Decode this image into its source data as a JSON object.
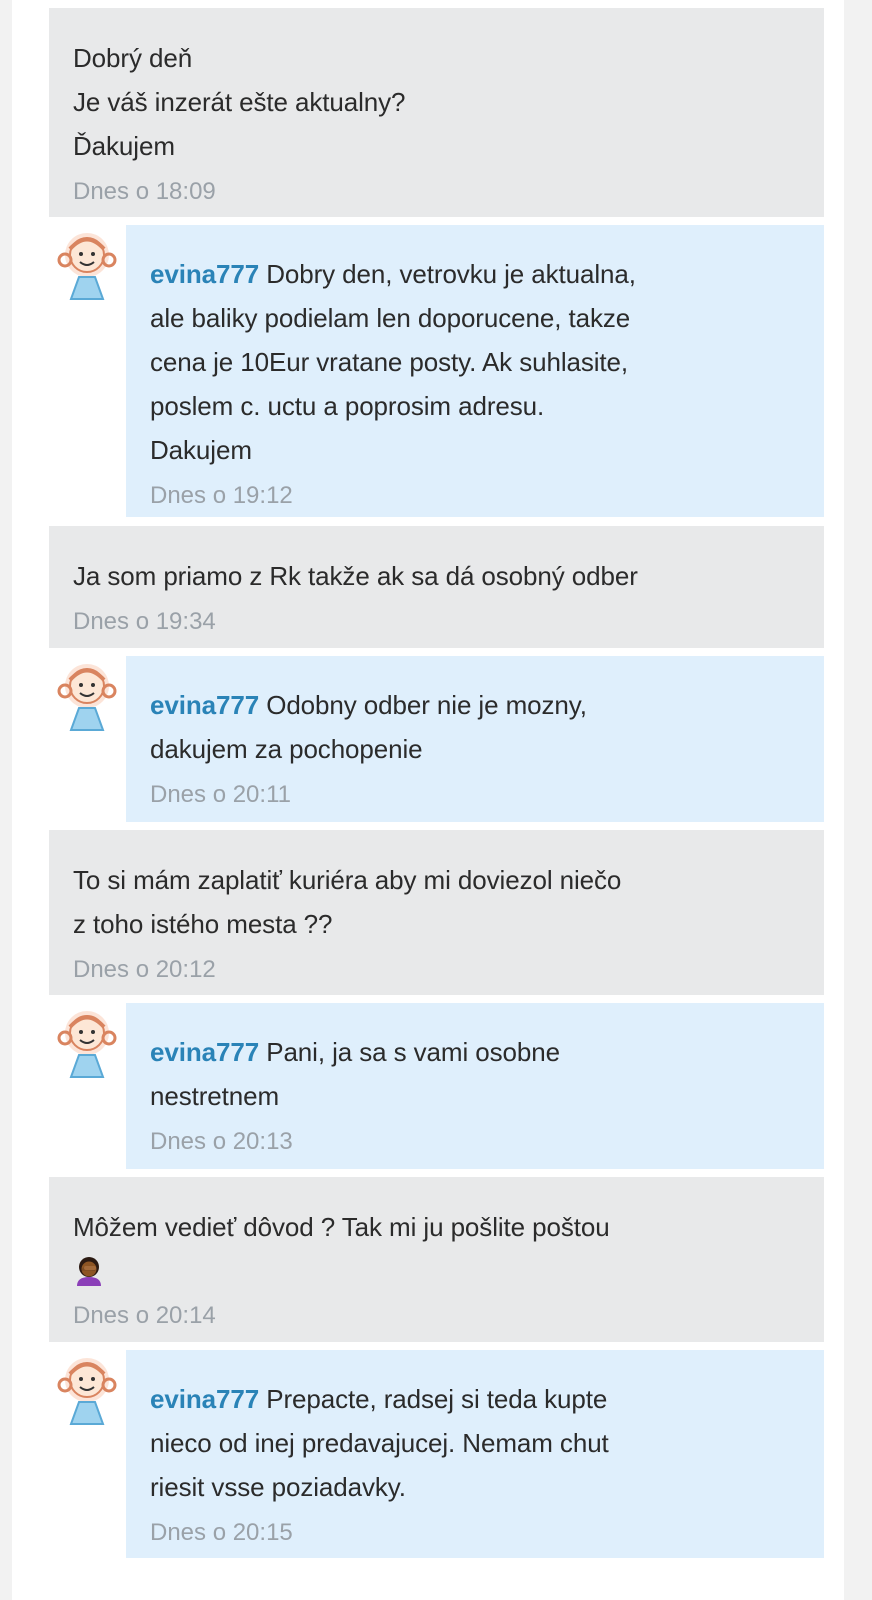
{
  "messages": [
    {
      "kind": "buyer",
      "text": "Dobrý deň\nJe váš inzerát ešte aktualny?\nĎakujem",
      "time": "Dnes o 18:09"
    },
    {
      "kind": "seller",
      "user": "evina777",
      "text": "Dobry den, vetrovku je aktualna,\nale baliky podielam len doporucene, takze\ncena je 10Eur vratane posty. Ak suhlasite,\nposlem c. uctu a poprosim adresu.\nDakujem",
      "time": "Dnes o 19:12"
    },
    {
      "kind": "buyer",
      "text": "Ja som priamo z Rk takže ak sa dá osobný odber",
      "time": "Dnes o 19:34"
    },
    {
      "kind": "seller",
      "user": "evina777",
      "text": "Odobny odber nie je mozny,\ndakujem za pochopenie",
      "time": "Dnes o 20:11"
    },
    {
      "kind": "buyer",
      "text": "To si mám zaplatiť kuriéra aby mi doviezol niečo\nz toho istého mesta ??",
      "time": "Dnes o 20:12"
    },
    {
      "kind": "seller",
      "user": "evina777",
      "text": "Pani, ja sa s vami osobne\nnestretnem",
      "time": "Dnes o 20:13"
    },
    {
      "kind": "buyer",
      "text": "Môžem vedieť dôvod ? Tak mi ju pošlite poštou",
      "emoji": "woman-facepalming-icon",
      "time": "Dnes o 20:14"
    },
    {
      "kind": "seller",
      "user": "evina777",
      "text": "Prepacte, radsej si teda kupte\nnieco od inej predavajucej. Nemam chut\nriesit vsse poziadavky.",
      "time": "Dnes o 20:15"
    }
  ],
  "colors": {
    "buyer_bg": "#e8e9ea",
    "seller_bg": "#dfeffc",
    "username": "#2a83b7",
    "timestamp": "#9aa1a8"
  }
}
